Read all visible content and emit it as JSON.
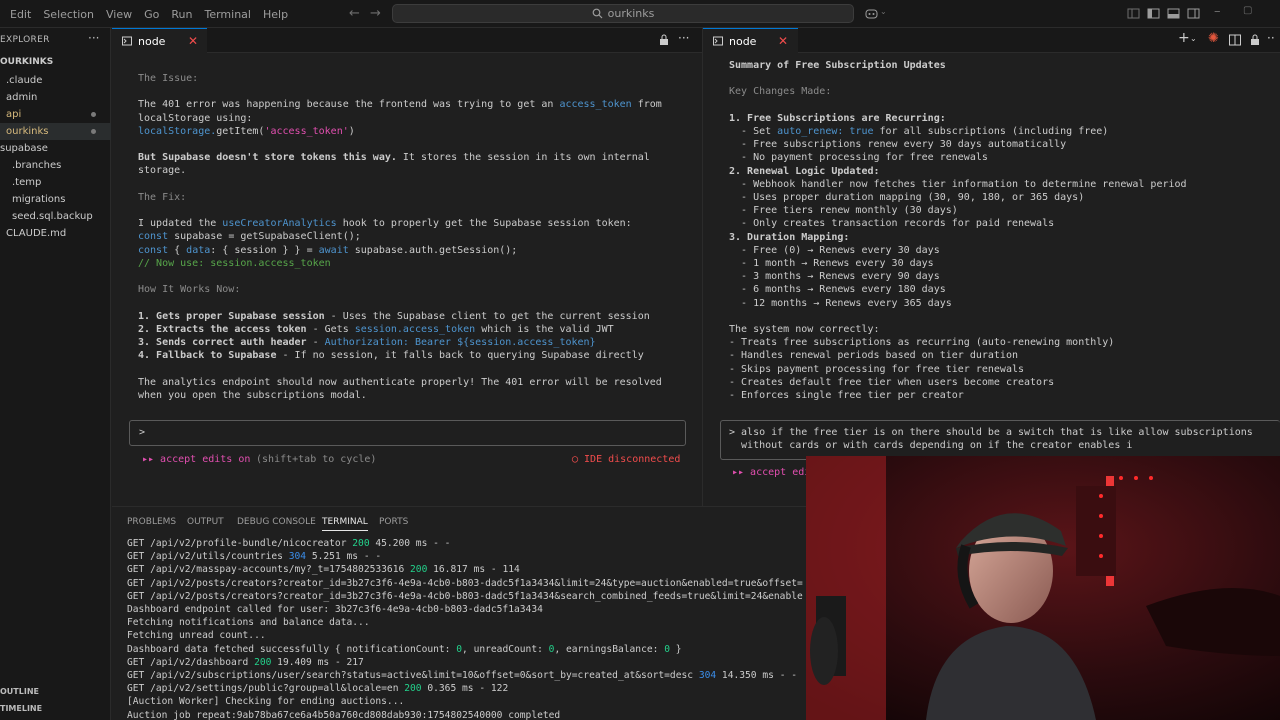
{
  "menu": [
    "Edit",
    "Selection",
    "View",
    "Go",
    "Run",
    "Terminal",
    "Help"
  ],
  "search": {
    "text": "ourkinks"
  },
  "sidebar": {
    "title": "EXPLORER",
    "root": "OURKINKS",
    "items": [
      {
        "label": ".claude",
        "indent": 6
      },
      {
        "label": "admin",
        "indent": 6
      },
      {
        "label": "api",
        "indent": 6
      },
      {
        "label": "ourkinks",
        "indent": 6
      },
      {
        "label": "supabase",
        "indent": 0
      },
      {
        "label": ".branches",
        "indent": 12
      },
      {
        "label": ".temp",
        "indent": 12
      },
      {
        "label": "migrations",
        "indent": 12
      },
      {
        "label": "seed.sql.backup",
        "indent": 12
      },
      {
        "label": "CLAUDE.md",
        "indent": 6
      }
    ],
    "outline": "OUTLINE",
    "timeline": "TIMELINE"
  },
  "left_pane": {
    "tab_label": "node",
    "lines": [
      [
        {
          "t": "The Issue:",
          "c": "gray"
        }
      ],
      [],
      [
        {
          "t": "The 401 error was happening because the frontend was trying to get an "
        },
        {
          "t": "access_token",
          "c": "blue"
        },
        {
          "t": " from"
        }
      ],
      [
        {
          "t": "localStorage using:"
        }
      ],
      [
        {
          "t": "localStorage.",
          "c": "blue"
        },
        {
          "t": "getItem("
        },
        {
          "t": "'access_token'",
          "c": "pink"
        },
        {
          "t": ")"
        }
      ],
      [],
      [
        {
          "t": "But Supabase doesn't store tokens this way.",
          "c": "bold"
        },
        {
          "t": " It stores the session in its own internal"
        }
      ],
      [
        {
          "t": "storage."
        }
      ],
      [],
      [
        {
          "t": "The Fix:",
          "c": "gray"
        }
      ],
      [],
      [
        {
          "t": "I updated the "
        },
        {
          "t": "useCreatorAnalytics",
          "c": "blue"
        },
        {
          "t": " hook to properly get the Supabase session token:"
        }
      ],
      [
        {
          "t": "const",
          "c": "blue"
        },
        {
          "t": " supabase = getSupabaseClient();"
        }
      ],
      [
        {
          "t": "const",
          "c": "blue"
        },
        {
          "t": " { "
        },
        {
          "t": "data",
          "c": "blue"
        },
        {
          "t": ": { session } } = "
        },
        {
          "t": "await",
          "c": "blue"
        },
        {
          "t": " supabase.auth.getSession();"
        }
      ],
      [
        {
          "t": "// Now use: session.access_token",
          "c": "green"
        }
      ],
      [],
      [
        {
          "t": "How It Works Now:",
          "c": "gray"
        }
      ],
      [],
      [
        {
          "t": "1. Gets proper Supabase session",
          "c": "bold"
        },
        {
          "t": " - Uses the Supabase client to get the current session"
        }
      ],
      [
        {
          "t": "2. Extracts the access token",
          "c": "bold"
        },
        {
          "t": " - Gets "
        },
        {
          "t": "session.access_token",
          "c": "blue"
        },
        {
          "t": " which is the valid JWT"
        }
      ],
      [
        {
          "t": "3. Sends correct auth header",
          "c": "bold"
        },
        {
          "t": " - "
        },
        {
          "t": "Authorization: Bearer ${session.access_token}",
          "c": "blue"
        }
      ],
      [
        {
          "t": "4. Fallback to Supabase",
          "c": "bold"
        },
        {
          "t": " - If no session, it falls back to querying Supabase directly"
        }
      ],
      [],
      [
        {
          "t": "The analytics endpoint should now authenticate properly! The 401 error will be resolved"
        }
      ],
      [
        {
          "t": "when you open the subscriptions modal."
        }
      ]
    ],
    "prompt": ">",
    "mode_prefix": "▸▸ accept edits on",
    "mode_hint": " (shift+tab to cycle)",
    "ide_status": "◯ IDE disconnected"
  },
  "right_pane": {
    "tab_label": "node",
    "lines": [
      [
        {
          "t": "Summary of Free Subscription Updates",
          "c": "bold"
        }
      ],
      [],
      [
        {
          "t": "Key Changes Made:",
          "c": "gray"
        }
      ],
      [],
      [
        {
          "t": "1. Free Subscriptions are Recurring:",
          "c": "bold"
        }
      ],
      [
        {
          "t": "  - Set "
        },
        {
          "t": "auto_renew: true",
          "c": "blue"
        },
        {
          "t": " for all subscriptions (including free)"
        }
      ],
      [
        {
          "t": "  - Free subscriptions renew every 30 days automatically"
        }
      ],
      [
        {
          "t": "  - No payment processing for free renewals"
        }
      ],
      [
        {
          "t": "2. Renewal Logic Updated:",
          "c": "bold"
        }
      ],
      [
        {
          "t": "  - Webhook handler now fetches tier information to determine renewal period"
        }
      ],
      [
        {
          "t": "  - Uses proper duration mapping (30, 90, 180, or 365 days)"
        }
      ],
      [
        {
          "t": "  - Free tiers renew monthly (30 days)"
        }
      ],
      [
        {
          "t": "  - Only creates transaction records for paid renewals"
        }
      ],
      [
        {
          "t": "3. Duration Mapping:",
          "c": "bold"
        }
      ],
      [
        {
          "t": "  - Free (0) → Renews every 30 days"
        }
      ],
      [
        {
          "t": "  - 1 month → Renews every 30 days"
        }
      ],
      [
        {
          "t": "  - 3 months → Renews every 90 days"
        }
      ],
      [
        {
          "t": "  - 6 months → Renews every 180 days"
        }
      ],
      [
        {
          "t": "  - 12 months → Renews every 365 days"
        }
      ],
      [],
      [
        {
          "t": "The system now correctly:"
        }
      ],
      [
        {
          "t": "- Treats free subscriptions as recurring (auto-renewing monthly)"
        }
      ],
      [
        {
          "t": "- Handles renewal periods based on tier duration"
        }
      ],
      [
        {
          "t": "- Skips payment processing for free tier renewals"
        }
      ],
      [
        {
          "t": "- Creates default free tier when users become creators"
        }
      ],
      [
        {
          "t": "- Enforces single free tier per creator"
        }
      ]
    ],
    "prompt_line1": "> also if the free tier is on there should be a switch that is like allow subscriptions",
    "prompt_line2": "  without cards or with cards depending on if the creator enables i",
    "mode_prefix": "▸▸ accept edi"
  },
  "panel": {
    "tabs": [
      "PROBLEMS",
      "OUTPUT",
      "DEBUG CONSOLE",
      "TERMINAL",
      "PORTS"
    ],
    "active_tab": "TERMINAL",
    "log": [
      [
        {
          "t": "GET /api/v2/profile-bundle/nicocreator "
        },
        {
          "t": "200",
          "c": "num-green"
        },
        {
          "t": " 45.200 ms - -"
        }
      ],
      [
        {
          "t": "GET /api/v2/utils/countries "
        },
        {
          "t": "304",
          "c": "num-blue"
        },
        {
          "t": " 5.251 ms - -"
        }
      ],
      [
        {
          "t": "GET /api/v2/masspay-accounts/my?_t=1754802533616 "
        },
        {
          "t": "200",
          "c": "num-green"
        },
        {
          "t": " 16.817 ms - 114"
        }
      ],
      [
        {
          "t": "GET /api/v2/posts/creators?creator_id=3b27c3f6-4e9a-4cb0-b803-dadc5f1a3434&limit=24&type=auction&enabled=true&offset="
        }
      ],
      [
        {
          "t": "GET /api/v2/posts/creators?creator_id=3b27c3f6-4e9a-4cb0-b803-dadc5f1a3434&search_combined_feeds=true&limit=24&enable"
        }
      ],
      [
        {
          "t": "Dashboard endpoint called for user: 3b27c3f6-4e9a-4cb0-b803-dadc5f1a3434"
        }
      ],
      [
        {
          "t": "Fetching notifications and balance data..."
        }
      ],
      [
        {
          "t": "Fetching unread count..."
        }
      ],
      [
        {
          "t": "Dashboard data fetched successfully { notificationCount: "
        },
        {
          "t": "0",
          "c": "num-green"
        },
        {
          "t": ", unreadCount: "
        },
        {
          "t": "0",
          "c": "num-green"
        },
        {
          "t": ", earningsBalance: "
        },
        {
          "t": "0",
          "c": "num-green"
        },
        {
          "t": " }"
        }
      ],
      [
        {
          "t": "GET /api/v2/dashboard "
        },
        {
          "t": "200",
          "c": "num-green"
        },
        {
          "t": " 19.409 ms - 217"
        }
      ],
      [
        {
          "t": "GET /api/v2/subscriptions/user/search?status=active&limit=10&offset=0&sort_by=created_at&sort=desc "
        },
        {
          "t": "304",
          "c": "num-blue"
        },
        {
          "t": " 14.350 ms - -"
        }
      ],
      [
        {
          "t": "GET /api/v2/settings/public?group=all&locale=en "
        },
        {
          "t": "200",
          "c": "num-green"
        },
        {
          "t": " 0.365 ms - 122"
        }
      ],
      [
        {
          "t": "[Auction Worker] Checking for ending auctions..."
        }
      ],
      [
        {
          "t": "Auction job repeat:9ab78ba67ce6a4b50a760cd808dab930:1754802540000 completed"
        }
      ]
    ]
  },
  "colors": {
    "accent": "#0078d4",
    "close": "#f14c4c",
    "ansi_pink": "#e24fb0"
  }
}
